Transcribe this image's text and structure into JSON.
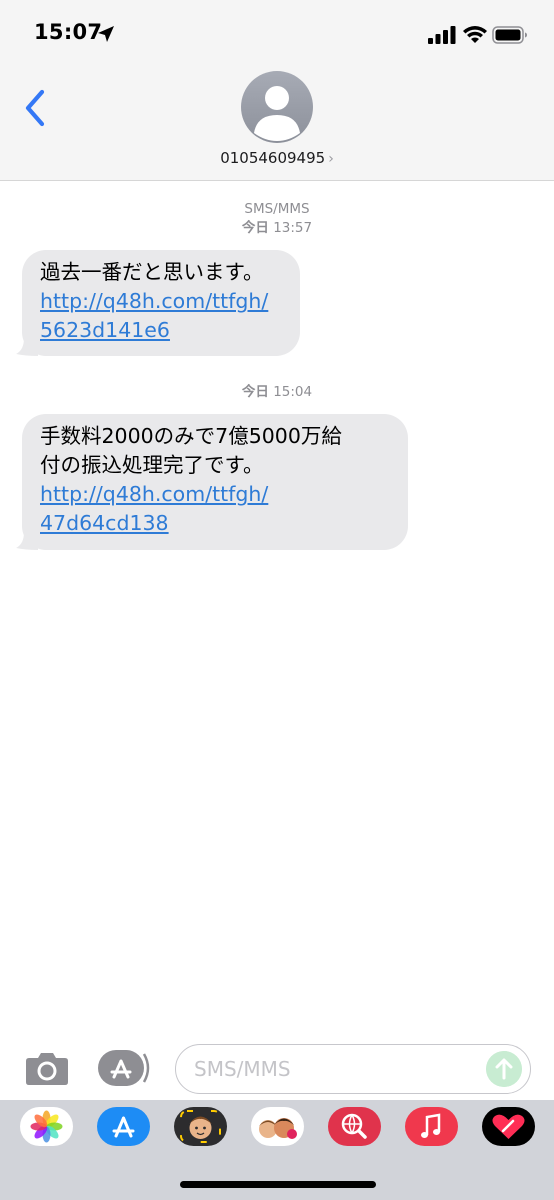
{
  "status_bar": {
    "time": "15:07"
  },
  "header": {
    "contact_number": "01054609495",
    "contact_chevron": "›"
  },
  "conversation": {
    "service_label": "SMS/MMS",
    "messages": [
      {
        "stamp_day": "今日",
        "stamp_time": "13:57",
        "text": "過去一番だと思います。",
        "link_line1": "http://q48h.com/ttfgh/",
        "link_line2": "5623d141e6"
      },
      {
        "stamp_day": "今日",
        "stamp_time": "15:04",
        "text_line1": "手数料2000のみで7億5000万給",
        "text_line2": "付の振込処理完了です。",
        "link_line1": "http://q48h.com/ttfgh/",
        "link_line2": "47d64cd138"
      }
    ]
  },
  "input_bar": {
    "placeholder": "SMS/MMS"
  },
  "app_drawer": {
    "apps": [
      "photos-icon",
      "app-store-icon",
      "memoji-icon",
      "memoji-stickers-icon",
      "web-search-icon",
      "music-icon",
      "digital-touch-icon"
    ]
  },
  "colors": {
    "link": "#2e7bd6",
    "bubble": "#e9e9eb",
    "back_chevron": "#3478f6",
    "send_disabled": "#c8ecd2"
  }
}
